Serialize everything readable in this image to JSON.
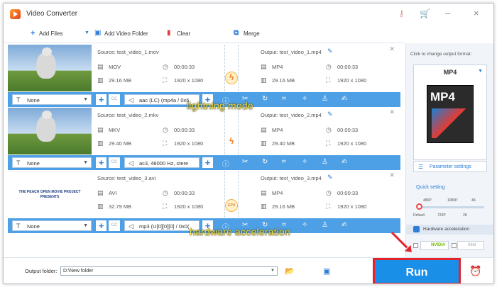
{
  "app": {
    "title": "Video Converter"
  },
  "toolbar": {
    "add_files": "Add Files",
    "add_folder": "Add Video Folder",
    "clear": "Clear",
    "merge": "Merge"
  },
  "rows": [
    {
      "source": "Source: test_video_1.mov",
      "src_fmt": "MOV",
      "src_dur": "00:00:33",
      "src_size": "29.16 MB",
      "src_res": "1920 x 1080",
      "output": "Output: test_video_1.mp4",
      "out_fmt": "MP4",
      "out_dur": "00:00:33",
      "out_size": "29.16 MB",
      "out_res": "1920 x 1080",
      "subtitle": "None",
      "audio": "aac (LC) (mp4a / 0x6"
    },
    {
      "source": "Source: test_video_2.mkv",
      "src_fmt": "MKV",
      "src_dur": "00:00:33",
      "src_size": "29.40 MB",
      "src_res": "1920 x 1080",
      "output": "Output: test_video_2.mp4",
      "out_fmt": "MP4",
      "out_dur": "00:00:33",
      "out_size": "29.40 MB",
      "out_res": "1920 x 1080",
      "subtitle": "None",
      "audio": "ac3, 48000 Hz, stere"
    },
    {
      "source": "Source: test_video_3.avi",
      "src_fmt": "AVI",
      "src_dur": "00:00:33",
      "src_size": "32.79 MB",
      "src_res": "1920 x 1080",
      "output": "Output: test_video_3.mp4",
      "out_fmt": "MP4",
      "out_dur": "00:00:33",
      "out_size": "29.16 MB",
      "out_res": "1920 x 1080",
      "subtitle": "None",
      "audio": "mp3 (U[0][0][0] / 0x0("
    }
  ],
  "thumb3_text": "THE PEACH OPEN MOVIE PROJECT PRESENTS",
  "gpu_label": "GPU",
  "annotations": {
    "lightning": "lightning mode",
    "hardware": "hardware acceleration"
  },
  "side": {
    "header": "Click to change output format:",
    "format": "MP4",
    "format_icon": "MP4",
    "param": "Parameter settings",
    "quick": "Quick setting",
    "ticks_top": [
      "480P",
      "1080P",
      "4K"
    ],
    "ticks_bottom": [
      "Default",
      "720P",
      "2K"
    ],
    "hw": "Hardware acceleration",
    "nvidia": "NVIDIA",
    "intel": "Intel"
  },
  "bottom": {
    "output_folder_label": "Output folder:",
    "path": "D:\\New folder",
    "run": "Run"
  },
  "colors": {
    "accent": "#1a8fe8",
    "bar": "#4da0e5",
    "highlight": "#e5232a"
  }
}
